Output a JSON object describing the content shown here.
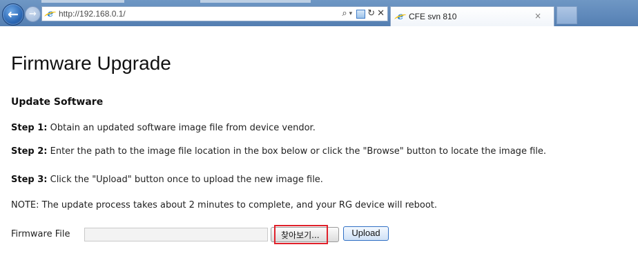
{
  "browser": {
    "url": "http://192.168.0.1/",
    "addr_tools": {
      "search_glyph": "⌕",
      "dropdown_glyph": "▾",
      "refresh_glyph": "↻",
      "stop_glyph": "✕"
    },
    "tab": {
      "title": "CFE svn 810",
      "close_glyph": "×"
    },
    "icons": {
      "back": "back-arrow-icon",
      "forward": "forward-arrow-icon",
      "page": "ie-page-icon",
      "search": "search-icon",
      "compat": "compatibility-view-icon",
      "refresh": "refresh-icon",
      "stop": "stop-icon"
    },
    "back_glyph": "←",
    "forward_glyph": "→",
    "ie_glyph": "e"
  },
  "page": {
    "title": "Firmware Upgrade",
    "section_heading": "Update Software",
    "steps": [
      {
        "label": "Step 1:",
        "text": " Obtain an updated software image file from device vendor."
      },
      {
        "label": "Step 2:",
        "text": " Enter the path to the image file location in the box below or click the \"Browse\" button to locate the image file."
      },
      {
        "label": "Step 3:",
        "text": " Click the \"Upload\" button once to upload the new image file."
      }
    ],
    "note": "NOTE: The update process takes about 2 minutes to complete, and your RG device will reboot.",
    "form": {
      "file_label": "Firmware File",
      "file_value": "",
      "browse_label": "찾아보기...",
      "upload_label": "Upload"
    }
  },
  "colors": {
    "chrome_blue": "#5e88ba",
    "highlight_red": "#e0202a",
    "upload_border": "#2f6fc4"
  }
}
